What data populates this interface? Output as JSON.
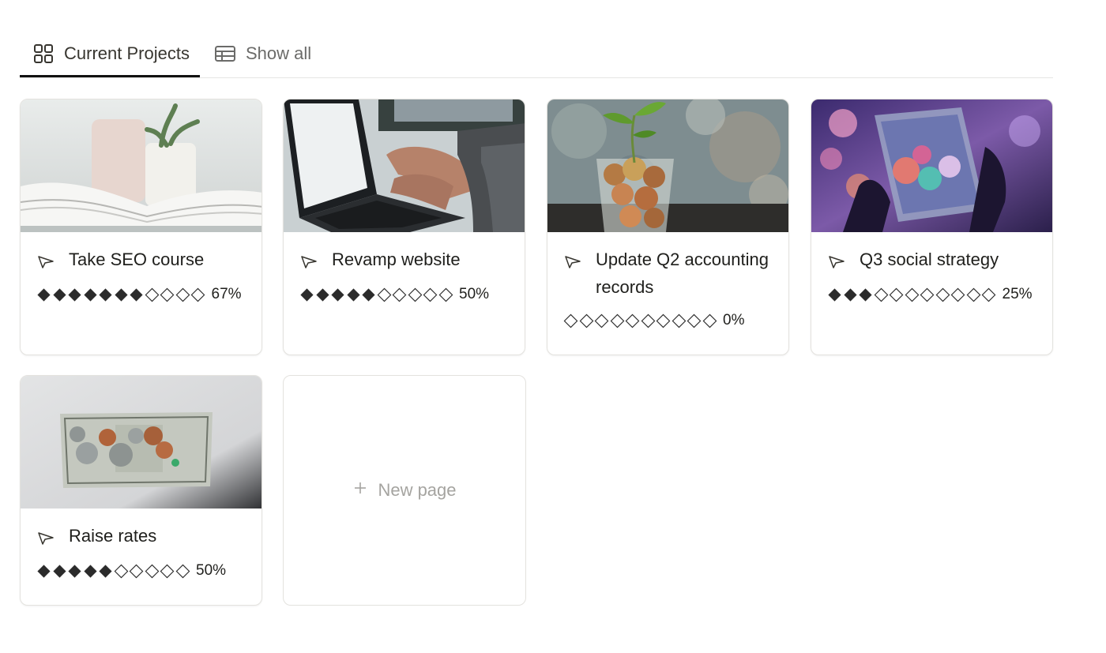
{
  "tabs": [
    {
      "label": "Current Projects",
      "icon": "gallery-grid-icon",
      "active": true
    },
    {
      "label": "Show all",
      "icon": "table-icon",
      "active": false
    }
  ],
  "cards": [
    {
      "title": "Take SEO course",
      "icon": "paper-plane-icon",
      "cover": "open-book-and-plant-photo",
      "filled": 7,
      "total": 11,
      "percent": "67%"
    },
    {
      "title": "Revamp website",
      "icon": "paper-plane-icon",
      "cover": "laptop-typing-photo",
      "filled": 5,
      "total": 10,
      "percent": "50%"
    },
    {
      "title": "Update Q2 accounting records",
      "icon": "paper-plane-icon",
      "cover": "coins-jar-plant-photo",
      "filled": 0,
      "total": 10,
      "percent": "0%"
    },
    {
      "title": "Q3 social strategy",
      "icon": "paper-plane-icon",
      "cover": "phone-bokeh-photo",
      "filled": 3,
      "total": 11,
      "percent": "25%"
    },
    {
      "title": "Raise rates",
      "icon": "paper-plane-icon",
      "cover": "dollar-bill-coins-photo",
      "filled": 5,
      "total": 10,
      "percent": "50%"
    }
  ],
  "new_page": {
    "label": "New page",
    "icon": "plus-icon"
  },
  "colors": {
    "diamond_filled": "#2b2b2b",
    "diamond_empty_stroke": "#2b2b2b",
    "tab_underline": "#111111",
    "muted_text": "#a5a4a0"
  }
}
